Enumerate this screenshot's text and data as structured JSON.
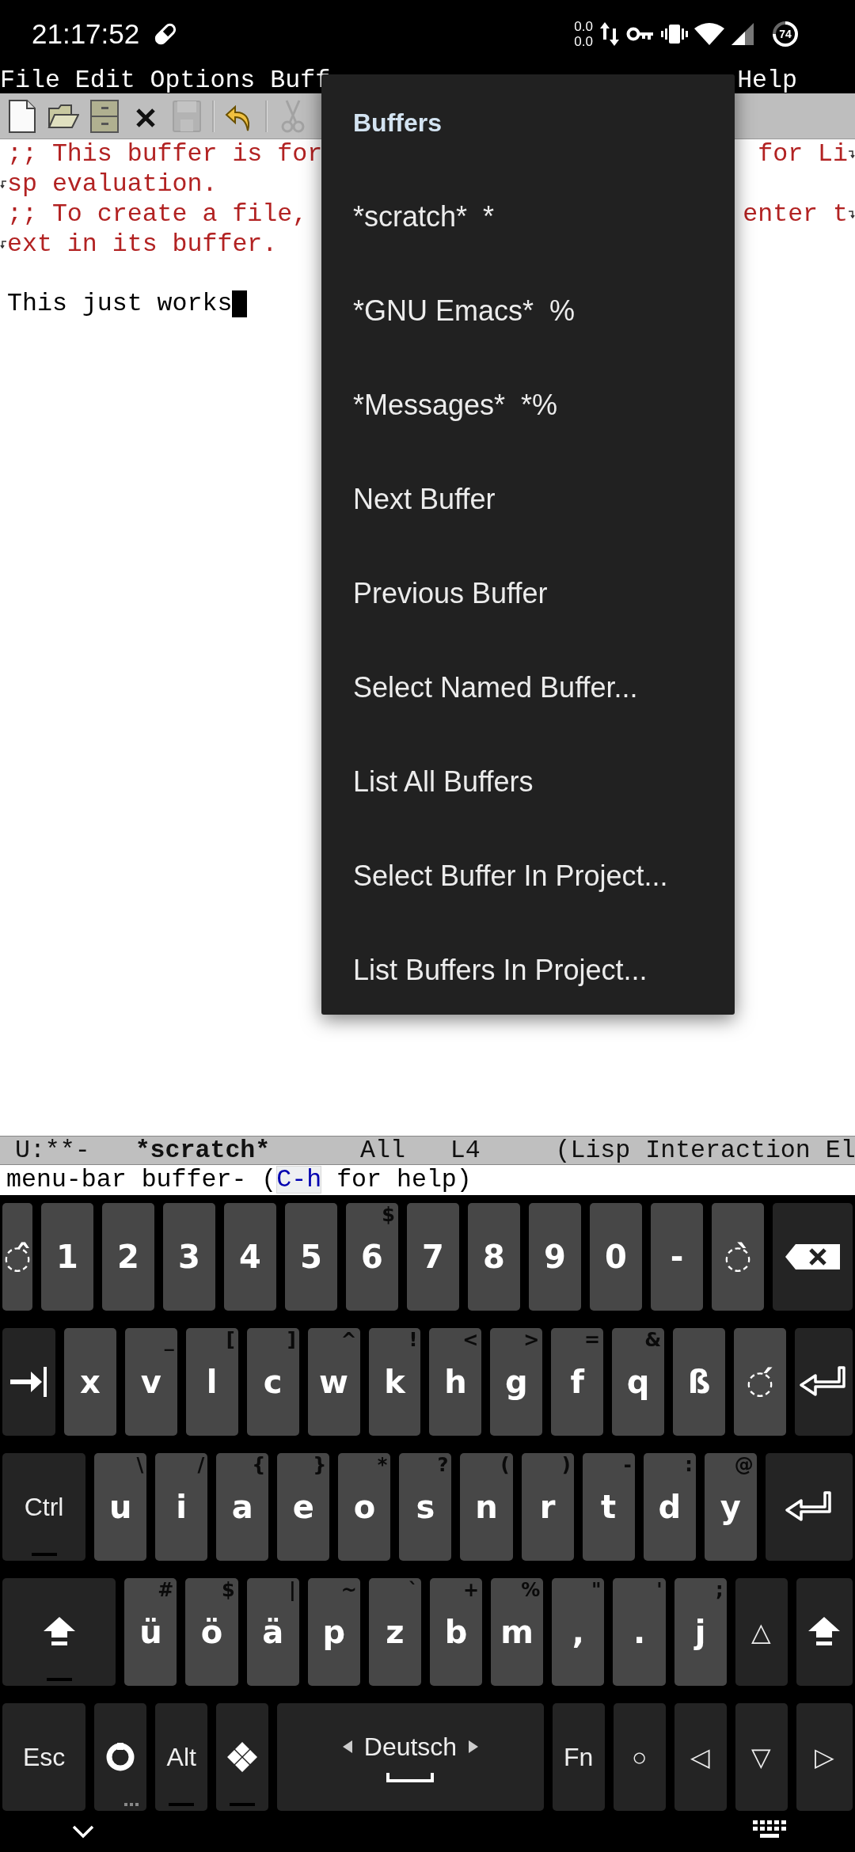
{
  "status_bar": {
    "time": "21:17:52",
    "data_rate_up": "0.0",
    "data_rate_down": "0.0",
    "battery": "74"
  },
  "menu_bar": {
    "items": [
      {
        "label": "File"
      },
      {
        "label": "Edit"
      },
      {
        "label": "Options"
      },
      {
        "label": "Buff"
      },
      {
        "label": "Help"
      }
    ]
  },
  "toolbar": {
    "buttons": [
      {
        "kind": "new",
        "disabled": false
      },
      {
        "kind": "open",
        "disabled": false
      },
      {
        "kind": "dired",
        "disabled": false
      },
      {
        "kind": "close",
        "disabled": false
      },
      {
        "kind": "save",
        "disabled": true
      },
      {
        "kind": "separator"
      },
      {
        "kind": "undo",
        "disabled": false
      },
      {
        "kind": "separator"
      },
      {
        "kind": "cut",
        "disabled": true
      }
    ]
  },
  "buffer": {
    "lines": [
      {
        "kind": "comment",
        "text": ";; This buffer is for",
        "tail": "for Li",
        "continued": false,
        "wrap": true,
        "cursor": false
      },
      {
        "kind": "comment",
        "text": "sp evaluation.",
        "continued": true,
        "wrap": false,
        "cursor": false
      },
      {
        "kind": "comment",
        "text": ";; To create a file,",
        "tail": "enter t",
        "continued": false,
        "wrap": true,
        "cursor": false
      },
      {
        "kind": "comment",
        "text": "ext in its buffer.",
        "continued": true,
        "wrap": false,
        "cursor": false
      },
      {
        "kind": "blank"
      },
      {
        "kind": "plain",
        "text": "This just works",
        "continued": false,
        "wrap": false,
        "cursor": true
      }
    ]
  },
  "mode_line": {
    "parts": [
      {
        "text": "U:**-",
        "bold": false
      },
      {
        "text": "*scratch*",
        "bold": true
      },
      {
        "text": "All",
        "bold": false
      },
      {
        "text": "L4",
        "bold": false
      },
      {
        "text": "(Lisp Interaction El",
        "bold": false
      }
    ]
  },
  "echo_area": {
    "before": "menu-bar buffer- (",
    "key": "C-h",
    "after": " for help)"
  },
  "popup_menu": {
    "title": "Buffers",
    "items": [
      {
        "label": "*scratch*  *"
      },
      {
        "label": "*GNU Emacs*  %"
      },
      {
        "label": "*Messages*  *%"
      },
      {
        "label": "Next Buffer"
      },
      {
        "label": "Previous Buffer"
      },
      {
        "label": "Select Named Buffer..."
      },
      {
        "label": "List All Buffers"
      },
      {
        "label": "Select Buffer In Project..."
      },
      {
        "label": "List Buffers In Project..."
      }
    ]
  },
  "keyboard": {
    "rows": [
      {
        "keys": [
          {
            "kind": "char",
            "label": "◌̂"
          },
          {
            "kind": "char",
            "label": "1"
          },
          {
            "kind": "char",
            "label": "2"
          },
          {
            "kind": "char",
            "label": "3"
          },
          {
            "kind": "char",
            "label": "4"
          },
          {
            "kind": "char",
            "label": "5"
          },
          {
            "kind": "char",
            "label": "6",
            "hint": "$"
          },
          {
            "kind": "char",
            "label": "7"
          },
          {
            "kind": "char",
            "label": "8"
          },
          {
            "kind": "char",
            "label": "9"
          },
          {
            "kind": "char",
            "label": "0"
          },
          {
            "kind": "char",
            "label": "-"
          },
          {
            "kind": "char",
            "label": "◌̀"
          },
          {
            "kind": "backspace"
          }
        ]
      },
      {
        "keys": [
          {
            "kind": "tab"
          },
          {
            "kind": "char",
            "label": "x"
          },
          {
            "kind": "char",
            "label": "v",
            "hint": "_"
          },
          {
            "kind": "char",
            "label": "l",
            "hint": "["
          },
          {
            "kind": "char",
            "label": "c",
            "hint": "]"
          },
          {
            "kind": "char",
            "label": "w",
            "hint": "^"
          },
          {
            "kind": "char",
            "label": "k",
            "hint": "!"
          },
          {
            "kind": "char",
            "label": "h",
            "hint": "<"
          },
          {
            "kind": "char",
            "label": "g",
            "hint": ">"
          },
          {
            "kind": "char",
            "label": "f",
            "hint": "="
          },
          {
            "kind": "char",
            "label": "q",
            "hint": "&"
          },
          {
            "kind": "char",
            "label": "ß"
          },
          {
            "kind": "char",
            "label": "◌́"
          },
          {
            "kind": "enter"
          }
        ]
      },
      {
        "keys": [
          {
            "kind": "label",
            "label": "Ctrl",
            "latch": true
          },
          {
            "kind": "char",
            "label": "u",
            "hint": "\\"
          },
          {
            "kind": "char",
            "label": "i",
            "hint": "/"
          },
          {
            "kind": "char",
            "label": "a",
            "hint": "{"
          },
          {
            "kind": "char",
            "label": "e",
            "hint": "}"
          },
          {
            "kind": "char",
            "label": "o",
            "hint": "*"
          },
          {
            "kind": "char",
            "label": "s",
            "hint": "?"
          },
          {
            "kind": "char",
            "label": "n",
            "hint": "("
          },
          {
            "kind": "char",
            "label": "r",
            "hint": ")"
          },
          {
            "kind": "char",
            "label": "t",
            "hint": "-"
          },
          {
            "kind": "char",
            "label": "d",
            "hint": ":"
          },
          {
            "kind": "char",
            "label": "y",
            "hint": "@"
          },
          {
            "kind": "enter"
          }
        ]
      },
      {
        "keys": [
          {
            "kind": "shift",
            "latch": true
          },
          {
            "kind": "char",
            "label": "ü",
            "hint": "#"
          },
          {
            "kind": "char",
            "label": "ö",
            "hint": "$"
          },
          {
            "kind": "char",
            "label": "ä",
            "hint": "|"
          },
          {
            "kind": "char",
            "label": "p",
            "hint": "~"
          },
          {
            "kind": "char",
            "label": "z",
            "hint": "`"
          },
          {
            "kind": "char",
            "label": "b",
            "hint": "+"
          },
          {
            "kind": "char",
            "label": "m",
            "hint": "%"
          },
          {
            "kind": "char",
            "label": ",",
            "hint": "\""
          },
          {
            "kind": "char",
            "label": ".",
            "hint": "'"
          },
          {
            "kind": "char",
            "label": "j",
            "hint": ";"
          },
          {
            "kind": "label",
            "label": "△"
          },
          {
            "kind": "shift"
          }
        ]
      },
      {
        "keys": [
          {
            "kind": "label",
            "label": "Esc"
          },
          {
            "kind": "compose",
            "more": true
          },
          {
            "kind": "label",
            "label": "Alt",
            "latch": true
          },
          {
            "kind": "super",
            "latch": true
          },
          {
            "kind": "space",
            "label": "Deutsch"
          },
          {
            "kind": "label",
            "label": "Fn"
          },
          {
            "kind": "label",
            "label": "○"
          },
          {
            "kind": "label",
            "label": "◁"
          },
          {
            "kind": "label",
            "label": "▽"
          },
          {
            "kind": "label",
            "label": "▷"
          }
        ]
      }
    ]
  }
}
